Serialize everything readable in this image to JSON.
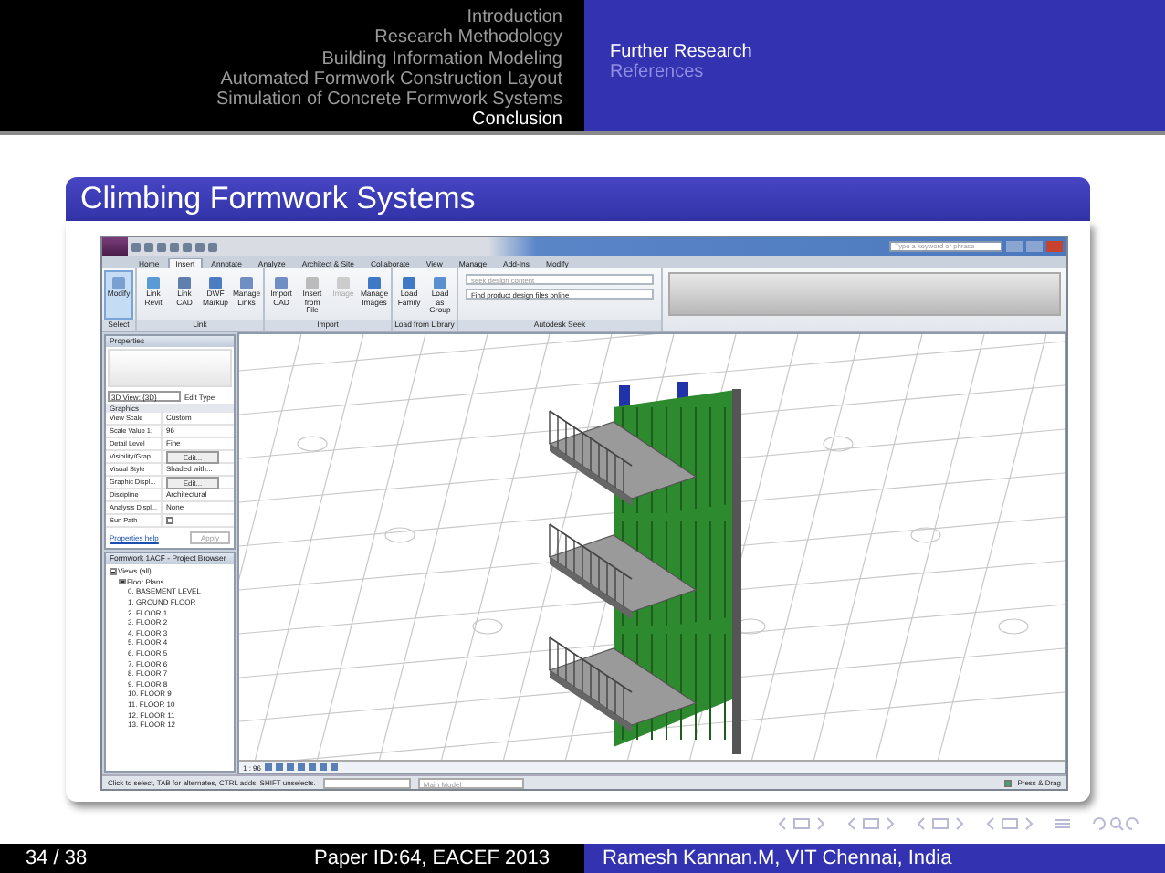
{
  "nav": {
    "sections": [
      {
        "label": "Introduction",
        "selected": false
      },
      {
        "label": "Research Methodology",
        "selected": false
      },
      {
        "label": "Building Information Modeling",
        "selected": false
      },
      {
        "label": "Automated Formwork Construction Layout",
        "selected": false
      },
      {
        "label": "Simulation of Concrete Formwork Systems",
        "selected": false
      },
      {
        "label": "Conclusion",
        "selected": true
      }
    ],
    "subsections": [
      {
        "label": "Further Research",
        "selected": true
      },
      {
        "label": "References",
        "selected": false
      }
    ]
  },
  "slide_title": "Climbing Formwork Systems",
  "app": {
    "search": {
      "placeholder": "Type a keyword or phrase"
    },
    "ribbon_tabs": [
      {
        "label": "Home",
        "selected": false
      },
      {
        "label": "Insert",
        "selected": true
      },
      {
        "label": "Annotate",
        "selected": false
      },
      {
        "label": "Analyze",
        "selected": false
      },
      {
        "label": "Architect & Site",
        "selected": false
      },
      {
        "label": "Collaborate",
        "selected": false
      },
      {
        "label": "View",
        "selected": false
      },
      {
        "label": "Manage",
        "selected": false
      },
      {
        "label": "Add-Ins",
        "selected": false
      },
      {
        "label": "Modify",
        "selected": false
      }
    ],
    "ribbon_groups": [
      {
        "label": "Select",
        "kind": "buttons",
        "buttons": [
          {
            "label": "Modify",
            "selected": true,
            "disabled": false
          }
        ]
      },
      {
        "label": "Link",
        "kind": "buttons",
        "buttons": [
          {
            "label": "Link Revit",
            "selected": false,
            "disabled": false
          },
          {
            "label": "Link CAD",
            "selected": false,
            "disabled": false
          },
          {
            "label": "DWF Markup",
            "selected": false,
            "disabled": false
          },
          {
            "label": "Manage Links",
            "selected": false,
            "disabled": false
          }
        ]
      },
      {
        "label": "Import",
        "kind": "buttons",
        "buttons": [
          {
            "label": "Import CAD",
            "selected": false,
            "disabled": false
          },
          {
            "label": "Insert from File",
            "selected": false,
            "disabled": false
          },
          {
            "label": "Image",
            "selected": false,
            "disabled": true
          },
          {
            "label": "Manage Images",
            "selected": false,
            "disabled": false
          }
        ]
      },
      {
        "label": "Load from Library",
        "kind": "buttons",
        "buttons": [
          {
            "label": "Load Family",
            "selected": false,
            "disabled": false
          },
          {
            "label": "Load as Group",
            "selected": false,
            "disabled": false
          }
        ]
      },
      {
        "label": "Autodesk Seek",
        "kind": "seek",
        "placeholder": "seek design content",
        "link": "Find product design files online"
      }
    ],
    "properties": {
      "title": "Properties",
      "type": "3D View: {3D}",
      "edit_type": "Edit Type",
      "section": "Graphics",
      "rows": [
        {
          "name": "View Scale",
          "kind": "text",
          "value": "Custom"
        },
        {
          "name": "Scale Value  1:",
          "kind": "text",
          "value": "96"
        },
        {
          "name": "Detail Level",
          "kind": "text",
          "value": "Fine"
        },
        {
          "name": "Visibility/Grap...",
          "kind": "button",
          "value": "Edit..."
        },
        {
          "name": "Visual Style",
          "kind": "text",
          "value": "Shaded with..."
        },
        {
          "name": "Graphic Displ...",
          "kind": "button",
          "value": "Edit..."
        },
        {
          "name": "Discipline",
          "kind": "text",
          "value": "Architectural"
        },
        {
          "name": "Analysis Displ...",
          "kind": "text",
          "value": "None"
        },
        {
          "name": "Sun Path",
          "kind": "checkbox",
          "checked": false
        }
      ],
      "help": "Properties help",
      "apply": "Apply"
    },
    "browser": {
      "title": "Formwork 1ACF - Project Browser",
      "tree": [
        {
          "label": "Views (all)",
          "expanded": true,
          "children": [
            {
              "label": "Floor Plans",
              "expanded": true,
              "children": [
                {
                  "label": "0. BASEMENT LEVEL"
                },
                {
                  "label": "1. GROUND FLOOR"
                },
                {
                  "label": "2. FLOOR 1"
                },
                {
                  "label": "3. FLOOR 2"
                },
                {
                  "label": "4. FLOOR 3"
                },
                {
                  "label": "5. FLOOR 4"
                },
                {
                  "label": "6. FLOOR 5"
                },
                {
                  "label": "7. FLOOR 6"
                },
                {
                  "label": "8. FLOOR 7"
                },
                {
                  "label": "9. FLOOR 8"
                },
                {
                  "label": "10. FLOOR 9"
                },
                {
                  "label": "11. FLOOR 10"
                },
                {
                  "label": "12. FLOOR 11"
                },
                {
                  "label": "13. FLOOR 12"
                }
              ]
            }
          ]
        }
      ]
    },
    "view_scale": "1 : 96",
    "status": {
      "hint": "Click to select, TAB for alternates, CTRL adds, SHIFT unselects.",
      "model": "Main Model",
      "press_drag": "Press & Drag",
      "press_drag_checked": true
    }
  },
  "footer": {
    "page": "34 / 38",
    "paper": "Paper ID:64, EACEF 2013",
    "author": "Ramesh Kannan.M, VIT Chennai, India"
  }
}
